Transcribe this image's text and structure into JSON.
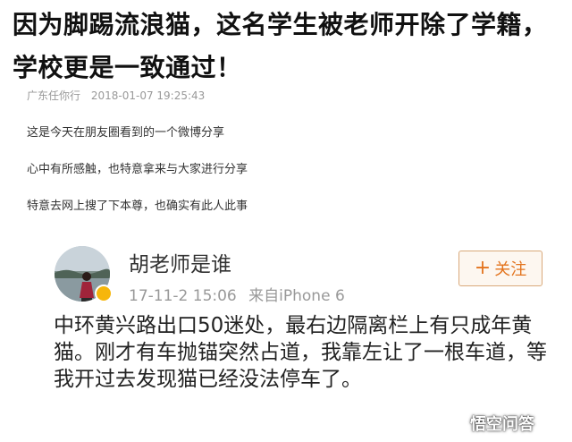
{
  "article": {
    "title": "因为脚踢流浪猫，这名学生被老师开除了学籍，学校更是一致通过！",
    "author": "广东任你行",
    "datetime": "2018-01-07 19:25:43",
    "paragraphs": [
      "这是今天在朋友圈看到的一个微博分享",
      "心中有所感触，也特意拿来与大家进行分享",
      "特意去网上搜了下本尊，也确实有此人此事"
    ]
  },
  "weibo": {
    "username": "胡老师是谁",
    "date": "17-11-2 15:06",
    "source": "来自iPhone 6",
    "follow_plus": "+",
    "follow_label": "关注",
    "content": "中环黄兴路出口50迷处，最右边隔离栏上有只成年黄猫。刚才有车抛锚突然占道，我靠左让了一根车道，等我开过去发现猫已经没法停车了。"
  },
  "watermark": {
    "text": "悟空问答"
  },
  "colors": {
    "title": "#111111",
    "meta": "#999999",
    "follow_text": "#e3741e",
    "follow_border": "#d9a97a",
    "verified_badge": "#f6b60b"
  }
}
